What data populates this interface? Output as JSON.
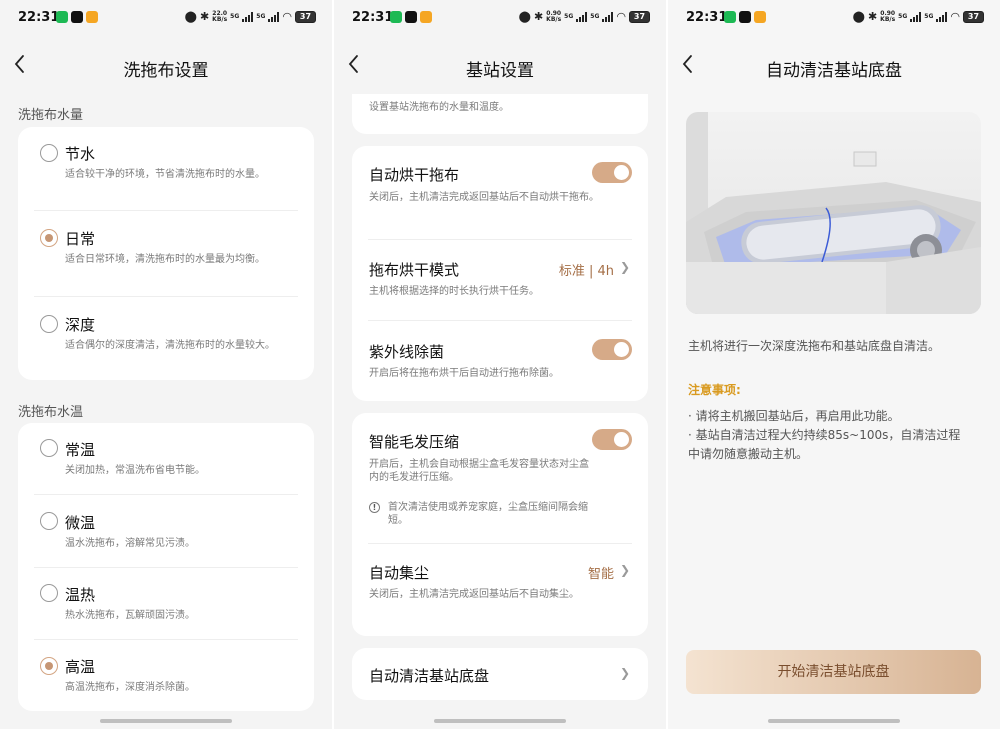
{
  "status": {
    "time": "22:31",
    "battery": "37",
    "net_s1_top": "22.0",
    "net_s1_bot": "KB/s",
    "net_top": "0.90",
    "net_bot": "KB/s",
    "sig1": "5G",
    "sig2": "5G"
  },
  "screen1": {
    "title": "洗拖布设置",
    "water_section": "洗拖布水量",
    "water_options": [
      {
        "title": "节水",
        "desc": "适合较干净的环境，节省清洗拖布时的水量。"
      },
      {
        "title": "日常",
        "desc": "适合日常环境，清洗拖布时的水量最为均衡。"
      },
      {
        "title": "深度",
        "desc": "适合偶尔的深度清洁，清洗拖布时的水量较大。"
      }
    ],
    "temp_section": "洗拖布水温",
    "temp_options": [
      {
        "title": "常温",
        "desc": "关闭加热，常温洗布省电节能。"
      },
      {
        "title": "微温",
        "desc": "温水洗拖布，溶解常见污渍。"
      },
      {
        "title": "温热",
        "desc": "热水洗拖布，瓦解顽固污渍。"
      },
      {
        "title": "高温",
        "desc": "高温洗拖布，深度消杀除菌。"
      }
    ],
    "selected_water": "日常",
    "selected_temp": "高温"
  },
  "screen2": {
    "title": "基站设置",
    "top_desc": "设置基站洗拖布的水量和温度。",
    "dry": {
      "title": "自动烘干拖布",
      "desc": "关闭后，主机清洁完成返回基站后不自动烘干拖布。",
      "on": true
    },
    "dry_mode": {
      "title": "拖布烘干模式",
      "value": "标准 | 4h",
      "desc": "主机将根据选择的时长执行烘干任务。"
    },
    "uv": {
      "title": "紫外线除菌",
      "desc": "开启后将在拖布烘干后自动进行拖布除菌。",
      "on": true
    },
    "hair": {
      "title": "智能毛发压缩",
      "desc": "开启后，主机会自动根据尘盒毛发容量状态对尘盒内的毛发进行压缩。",
      "note": "首次清洁使用或养宠家庭，尘盒压缩间隔会缩短。",
      "on": true
    },
    "dust": {
      "title": "自动集尘",
      "value": "智能",
      "desc": "关闭后，主机清洁完成返回基站后不自动集尘。"
    },
    "clean_tray": {
      "title": "自动清洁基站底盘"
    }
  },
  "screen3": {
    "title": "自动清洁基站底盘",
    "intro": "主机将进行一次深度洗拖布和基站底盘自清洁。",
    "notice_title": "注意事项:",
    "notice_1": "· 请将主机搬回基站后，再启用此功能。",
    "notice_2a": "· 基站自清洁过程大约持续85s~100s，自清洁过程",
    "notice_2b": "中请勿随意搬动主机。",
    "button": "开始清洁基站底盘"
  },
  "icons": {
    "back": "chevron-left-icon",
    "chevron": "chevron-right-icon",
    "info": "info-icon"
  },
  "colors": {
    "accent": "#d6aa88",
    "accent_text": "#a56f47",
    "warning": "#d99a1f"
  }
}
